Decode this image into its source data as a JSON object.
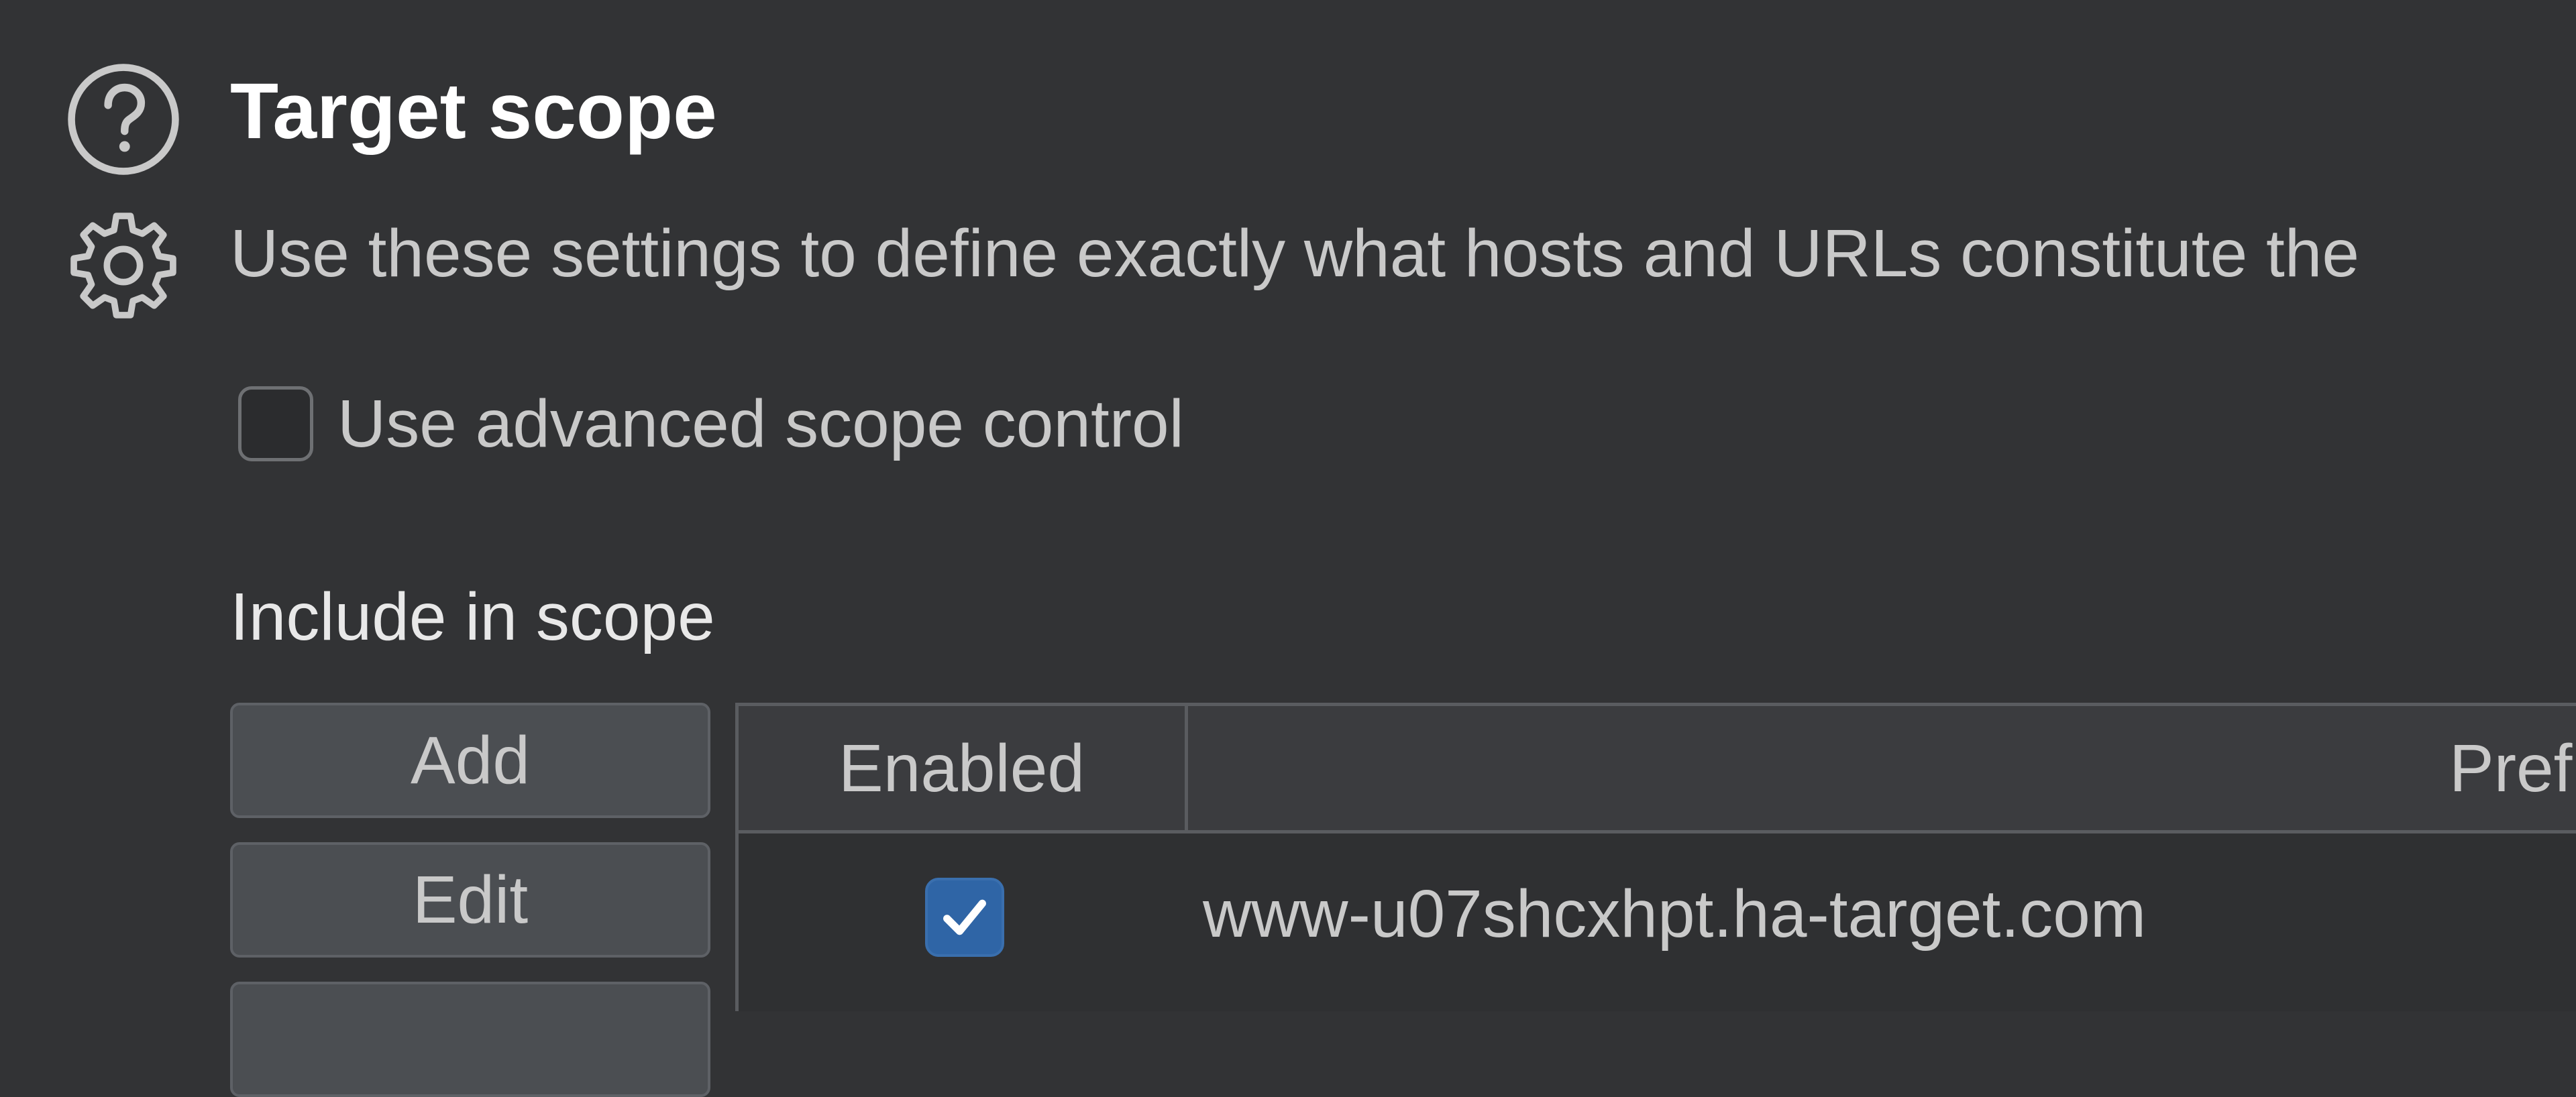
{
  "header": {
    "title": "Target scope",
    "description": "Use these settings to define exactly what hosts and URLs constitute the"
  },
  "advanced_scope": {
    "label": "Use advanced scope control",
    "checked": false
  },
  "include_section": {
    "label": "Include in scope",
    "buttons": {
      "add": "Add",
      "edit": "Edit"
    },
    "table": {
      "columns": [
        "Enabled",
        "Pref"
      ],
      "rows": [
        {
          "enabled": true,
          "prefix": "www-u07shcxhpt.ha-target.com"
        }
      ]
    }
  },
  "icons": {
    "help": "question-circle-icon",
    "settings": "gear-icon"
  },
  "colors": {
    "background": "#323335",
    "accent_checkbox": "#2f65a6",
    "title": "#ffffff",
    "text": "#c9c9c9"
  }
}
